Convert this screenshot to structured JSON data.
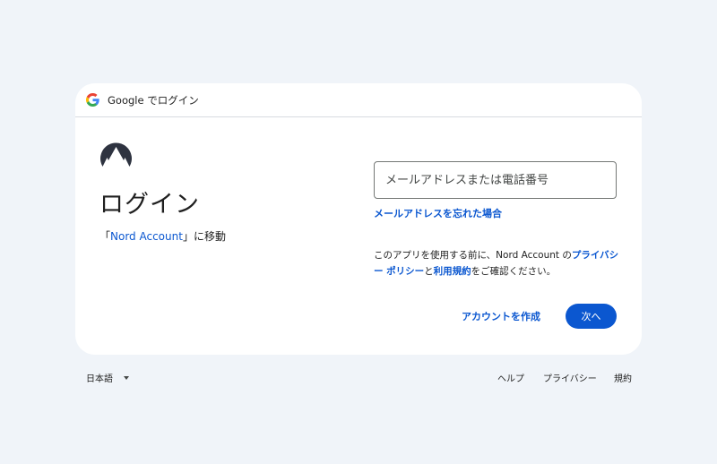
{
  "header": {
    "text": "Google でログイン"
  },
  "left": {
    "title": "ログイン",
    "subtitle_prefix": "「",
    "subtitle_link": "Nord Account",
    "subtitle_suffix": "」に移動"
  },
  "form": {
    "email_placeholder": "メールアドレスまたは電話番号",
    "email_value": "",
    "forgot_link": "メールアドレスを忘れた場合",
    "privacy_prefix": "このアプリを使用する前に、Nord Account の",
    "privacy_link": "プライバシー ポリシー",
    "privacy_and": "と",
    "terms_link": "利用規約",
    "privacy_suffix": "をご確認ください。",
    "create_account_label": "アカウントを作成",
    "next_label": "次へ"
  },
  "footer": {
    "language": "日本語",
    "help": "ヘルプ",
    "privacy": "プライバシー",
    "terms": "規約"
  },
  "colors": {
    "accent": "#0b57d0",
    "page_background": "#f0f4f9",
    "card_background": "#ffffff"
  }
}
